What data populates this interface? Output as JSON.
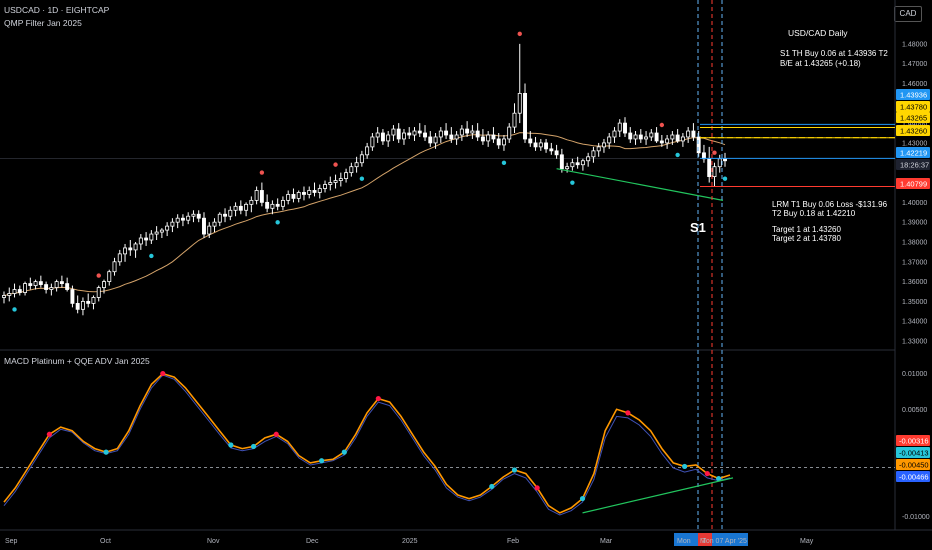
{
  "header": {
    "symbol_line": "USDCAD · 1D · EIGHTCAP",
    "indicator_line": "QMP Filter Jan 2025",
    "currency": "CAD"
  },
  "macd_header": "MACD Platinum + QQE ADV Jan 2025",
  "annotations": {
    "title": "USD/CAD Daily",
    "s1_line1": "S1 TH Buy 0.06 at 1.43936 T2",
    "s1_line2": "B/E at 1.43265 (+0.18)",
    "lrm_line1": "LRM T1 Buy 0.06 Loss -$131.96",
    "lrm_line2": "T2 Buy 0.18 at 1.42210",
    "target1": "Target 1 at 1.43260",
    "target2": "Target 2 at 1.43780",
    "s1_marker": "S1"
  },
  "time_axis": {
    "labels": [
      "Sep",
      "Oct",
      "Nov",
      "Dec",
      "2025",
      "Feb",
      "Mar",
      "May"
    ],
    "highlight_left": "Mon",
    "highlight_mid": "T",
    "highlight_right": "Mon 07 Apr '25"
  },
  "colors": {
    "background": "#000000",
    "up_candle": "#ffffff",
    "down_candle": "#ffffff",
    "ma_line": "#d4a36a",
    "trend_green": "#22c55e",
    "blue_line": "#2196f3",
    "yellow_line": "#ffd600",
    "red_line": "#ff3b30",
    "macd_orange": "#ff9800",
    "macd_blue": "#1e3a8a",
    "dot_red": "#ef5350",
    "dot_cyan": "#26c6da"
  },
  "chart_data": [
    {
      "type": "candlestick",
      "title": "USDCAD · 1D · EIGHTCAP",
      "y_ticks": [
        "1.48000",
        "1.47000",
        "1.46000",
        "1.45000",
        "1.44000",
        "1.43000",
        "1.42000",
        "1.41000",
        "1.40000",
        "1.39000",
        "1.38000",
        "1.37000",
        "1.36000",
        "1.35000",
        "1.34000",
        "1.33000"
      ],
      "ylim": [
        1.328,
        1.487
      ],
      "x_labels": [
        "Sep",
        "Oct",
        "Nov",
        "Dec",
        "2025",
        "Feb",
        "Mar",
        "May"
      ],
      "ohlc": [
        [
          1.352,
          1.355,
          1.349,
          1.353
        ],
        [
          1.353,
          1.357,
          1.35,
          1.354
        ],
        [
          1.354,
          1.359,
          1.352,
          1.356
        ],
        [
          1.356,
          1.358,
          1.353,
          1.3545
        ],
        [
          1.3545,
          1.36,
          1.353,
          1.359
        ],
        [
          1.359,
          1.362,
          1.356,
          1.358
        ],
        [
          1.358,
          1.361,
          1.356,
          1.36
        ],
        [
          1.36,
          1.363,
          1.357,
          1.3585
        ],
        [
          1.3585,
          1.36,
          1.354,
          1.356
        ],
        [
          1.356,
          1.359,
          1.353,
          1.357
        ],
        [
          1.357,
          1.361,
          1.355,
          1.36
        ],
        [
          1.36,
          1.363,
          1.357,
          1.359
        ],
        [
          1.359,
          1.362,
          1.355,
          1.356
        ],
        [
          1.356,
          1.358,
          1.347,
          1.349
        ],
        [
          1.349,
          1.353,
          1.344,
          1.346
        ],
        [
          1.346,
          1.352,
          1.343,
          1.35
        ],
        [
          1.35,
          1.354,
          1.347,
          1.349
        ],
        [
          1.349,
          1.353,
          1.346,
          1.352
        ],
        [
          1.352,
          1.358,
          1.35,
          1.357
        ],
        [
          1.357,
          1.361,
          1.354,
          1.36
        ],
        [
          1.36,
          1.366,
          1.358,
          1.365
        ],
        [
          1.365,
          1.372,
          1.363,
          1.37
        ],
        [
          1.37,
          1.376,
          1.368,
          1.374
        ],
        [
          1.374,
          1.379,
          1.37,
          1.377
        ],
        [
          1.377,
          1.381,
          1.373,
          1.376
        ],
        [
          1.376,
          1.38,
          1.372,
          1.379
        ],
        [
          1.379,
          1.384,
          1.376,
          1.382
        ],
        [
          1.382,
          1.385,
          1.378,
          1.381
        ],
        [
          1.381,
          1.386,
          1.379,
          1.384
        ],
        [
          1.384,
          1.388,
          1.381,
          1.385
        ],
        [
          1.385,
          1.387,
          1.382,
          1.386
        ],
        [
          1.386,
          1.39,
          1.383,
          1.388
        ],
        [
          1.388,
          1.392,
          1.385,
          1.39
        ],
        [
          1.39,
          1.394,
          1.387,
          1.392
        ],
        [
          1.392,
          1.394,
          1.388,
          1.391
        ],
        [
          1.391,
          1.395,
          1.389,
          1.393
        ],
        [
          1.393,
          1.396,
          1.39,
          1.394
        ],
        [
          1.394,
          1.396,
          1.39,
          1.392
        ],
        [
          1.392,
          1.395,
          1.382,
          1.384
        ],
        [
          1.384,
          1.39,
          1.382,
          1.388
        ],
        [
          1.388,
          1.392,
          1.385,
          1.39
        ],
        [
          1.39,
          1.395,
          1.388,
          1.394
        ],
        [
          1.394,
          1.397,
          1.39,
          1.393
        ],
        [
          1.393,
          1.398,
          1.391,
          1.396
        ],
        [
          1.396,
          1.4,
          1.393,
          1.398
        ],
        [
          1.398,
          1.401,
          1.394,
          1.396
        ],
        [
          1.396,
          1.4,
          1.393,
          1.399
        ],
        [
          1.399,
          1.403,
          1.395,
          1.401
        ],
        [
          1.401,
          1.408,
          1.399,
          1.406
        ],
        [
          1.406,
          1.41,
          1.398,
          1.4
        ],
        [
          1.4,
          1.404,
          1.395,
          1.397
        ],
        [
          1.397,
          1.401,
          1.394,
          1.399
        ],
        [
          1.399,
          1.402,
          1.396,
          1.398
        ],
        [
          1.398,
          1.403,
          1.396,
          1.401
        ],
        [
          1.401,
          1.406,
          1.399,
          1.404
        ],
        [
          1.404,
          1.407,
          1.4,
          1.402
        ],
        [
          1.402,
          1.406,
          1.4,
          1.405
        ],
        [
          1.405,
          1.408,
          1.401,
          1.404
        ],
        [
          1.404,
          1.408,
          1.402,
          1.406
        ],
        [
          1.406,
          1.41,
          1.403,
          1.405
        ],
        [
          1.405,
          1.409,
          1.402,
          1.407
        ],
        [
          1.407,
          1.411,
          1.405,
          1.409
        ],
        [
          1.409,
          1.413,
          1.406,
          1.41
        ],
        [
          1.41,
          1.414,
          1.407,
          1.411
        ],
        [
          1.411,
          1.415,
          1.408,
          1.412
        ],
        [
          1.412,
          1.417,
          1.41,
          1.415
        ],
        [
          1.415,
          1.42,
          1.413,
          1.418
        ],
        [
          1.418,
          1.423,
          1.415,
          1.42
        ],
        [
          1.42,
          1.426,
          1.418,
          1.424
        ],
        [
          1.424,
          1.43,
          1.422,
          1.428
        ],
        [
          1.428,
          1.435,
          1.426,
          1.433
        ],
        [
          1.433,
          1.438,
          1.43,
          1.435
        ],
        [
          1.435,
          1.437,
          1.429,
          1.431
        ],
        [
          1.431,
          1.436,
          1.428,
          1.434
        ],
        [
          1.434,
          1.439,
          1.431,
          1.437
        ],
        [
          1.437,
          1.44,
          1.43,
          1.432
        ],
        [
          1.432,
          1.437,
          1.429,
          1.435
        ],
        [
          1.435,
          1.438,
          1.432,
          1.434
        ],
        [
          1.434,
          1.438,
          1.431,
          1.436
        ],
        [
          1.436,
          1.44,
          1.433,
          1.435
        ],
        [
          1.435,
          1.439,
          1.431,
          1.433
        ],
        [
          1.433,
          1.436,
          1.428,
          1.43
        ],
        [
          1.43,
          1.435,
          1.427,
          1.433
        ],
        [
          1.433,
          1.438,
          1.43,
          1.436
        ],
        [
          1.436,
          1.44,
          1.432,
          1.434
        ],
        [
          1.434,
          1.438,
          1.43,
          1.432
        ],
        [
          1.432,
          1.436,
          1.429,
          1.434
        ],
        [
          1.434,
          1.439,
          1.431,
          1.437
        ],
        [
          1.437,
          1.441,
          1.433,
          1.435
        ],
        [
          1.435,
          1.439,
          1.432,
          1.436
        ],
        [
          1.436,
          1.44,
          1.431,
          1.433
        ],
        [
          1.433,
          1.437,
          1.429,
          1.431
        ],
        [
          1.431,
          1.436,
          1.428,
          1.434
        ],
        [
          1.434,
          1.438,
          1.43,
          1.432
        ],
        [
          1.432,
          1.435,
          1.427,
          1.429
        ],
        [
          1.429,
          1.434,
          1.426,
          1.432
        ],
        [
          1.432,
          1.44,
          1.43,
          1.438
        ],
        [
          1.438,
          1.45,
          1.435,
          1.445
        ],
        [
          1.445,
          1.48,
          1.44,
          1.455
        ],
        [
          1.455,
          1.46,
          1.43,
          1.432
        ],
        [
          1.432,
          1.436,
          1.428,
          1.43
        ],
        [
          1.43,
          1.433,
          1.426,
          1.428
        ],
        [
          1.428,
          1.432,
          1.426,
          1.43
        ],
        [
          1.43,
          1.432,
          1.425,
          1.427
        ],
        [
          1.427,
          1.43,
          1.424,
          1.426
        ],
        [
          1.426,
          1.429,
          1.422,
          1.424
        ],
        [
          1.424,
          1.427,
          1.415,
          1.417
        ],
        [
          1.417,
          1.42,
          1.415,
          1.418
        ],
        [
          1.418,
          1.422,
          1.416,
          1.42
        ],
        [
          1.42,
          1.423,
          1.417,
          1.419
        ],
        [
          1.419,
          1.422,
          1.416,
          1.421
        ],
        [
          1.421,
          1.425,
          1.418,
          1.423
        ],
        [
          1.423,
          1.428,
          1.42,
          1.426
        ],
        [
          1.426,
          1.43,
          1.423,
          1.428
        ],
        [
          1.428,
          1.432,
          1.425,
          1.43
        ],
        [
          1.43,
          1.435,
          1.427,
          1.433
        ],
        [
          1.433,
          1.438,
          1.43,
          1.436
        ],
        [
          1.436,
          1.442,
          1.433,
          1.44
        ],
        [
          1.44,
          1.443,
          1.433,
          1.435
        ],
        [
          1.435,
          1.438,
          1.43,
          1.432
        ],
        [
          1.432,
          1.436,
          1.429,
          1.434
        ],
        [
          1.434,
          1.437,
          1.43,
          1.432
        ],
        [
          1.432,
          1.436,
          1.429,
          1.433
        ],
        [
          1.433,
          1.437,
          1.431,
          1.435
        ],
        [
          1.435,
          1.438,
          1.43,
          1.431
        ],
        [
          1.431,
          1.434,
          1.428,
          1.43
        ],
        [
          1.43,
          1.434,
          1.427,
          1.432
        ],
        [
          1.432,
          1.436,
          1.429,
          1.434
        ],
        [
          1.434,
          1.437,
          1.43,
          1.431
        ],
        [
          1.431,
          1.435,
          1.428,
          1.433
        ],
        [
          1.433,
          1.438,
          1.43,
          1.436
        ],
        [
          1.436,
          1.44,
          1.431,
          1.433
        ],
        [
          1.433,
          1.436,
          1.423,
          1.425
        ],
        [
          1.425,
          1.429,
          1.42,
          1.422
        ],
        [
          1.422,
          1.428,
          1.41,
          1.413
        ],
        [
          1.413,
          1.42,
          1.408,
          1.418
        ],
        [
          1.418,
          1.424,
          1.415,
          1.422
        ],
        [
          1.422,
          1.425,
          1.418,
          1.421
        ]
      ]
    },
    {
      "type": "line",
      "title": "MACD Platinum + QQE ADV Jan 2025",
      "y_ticks": [
        "0.01000",
        "0.00500",
        "-0.01000"
      ],
      "ylim": [
        -0.0105,
        0.0112
      ],
      "series": [
        {
          "values": [
            -0.008,
            -0.006,
            -0.0035,
            -0.001,
            0.0015,
            0.0025,
            0.002,
            0.0005,
            -0.0005,
            -0.001,
            -0.0005,
            0.002,
            0.0055,
            0.0085,
            0.01,
            0.0095,
            0.008,
            0.006,
            0.004,
            0.002,
            0.0,
            -0.0005,
            -0.0002,
            0.001,
            0.0015,
            0.0005,
            -0.0015,
            -0.0025,
            -0.0022,
            -0.002,
            -0.001,
            0.0015,
            0.0045,
            0.0065,
            0.006,
            0.004,
            0.0015,
            -0.001,
            -0.003,
            -0.0055,
            -0.007,
            -0.0075,
            -0.007,
            -0.0058,
            -0.0045,
            -0.0035,
            -0.004,
            -0.006,
            -0.0085,
            -0.0095,
            -0.0088,
            -0.0075,
            -0.004,
            0.002,
            0.005,
            0.0045,
            0.0035,
            0.002,
            -0.0005,
            -0.0025,
            -0.003,
            -0.0028,
            -0.004,
            -0.0047,
            -0.0042
          ]
        },
        {
          "values": [
            -0.0085,
            -0.0065,
            -0.004,
            -0.0015,
            0.001,
            0.0022,
            0.0018,
            0.0003,
            -0.0008,
            -0.0012,
            -0.0008,
            0.0015,
            0.005,
            0.008,
            0.0098,
            0.0092,
            0.0075,
            0.0055,
            0.0035,
            0.0015,
            -0.0004,
            -0.0008,
            -0.0005,
            0.0005,
            0.0012,
            0.0002,
            -0.0018,
            -0.0028,
            -0.0025,
            -0.0022,
            -0.0014,
            0.001,
            0.004,
            0.006,
            0.0055,
            0.0035,
            0.001,
            -0.0015,
            -0.0035,
            -0.006,
            -0.0073,
            -0.0078,
            -0.0073,
            -0.0062,
            -0.0048,
            -0.004,
            -0.0046,
            -0.0066,
            -0.009,
            -0.0098,
            -0.0092,
            -0.008,
            -0.0048,
            0.001,
            0.004,
            0.0038,
            0.0028,
            0.0012,
            -0.0012,
            -0.0032,
            -0.0038,
            -0.0034,
            -0.0046,
            -0.005,
            -0.0046
          ]
        }
      ]
    }
  ],
  "price_labels": {
    "p1": "1.43936",
    "p2": "1.43780",
    "p3": "1.43265",
    "p4": "1.43260",
    "p5": "1.42219",
    "p5_time": "18:26:37",
    "p6": "1.40799",
    "m1": "-0.00316",
    "m2": "-0.00413",
    "m3": "-0.00450",
    "m4": "-0.00466"
  }
}
